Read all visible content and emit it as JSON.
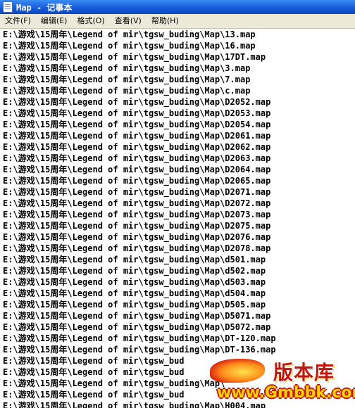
{
  "window": {
    "title": "Map - 记事本",
    "icon": "notepad-icon"
  },
  "menu": [
    {
      "label": "文件(F)",
      "name": "menu-file"
    },
    {
      "label": "编辑(E)",
      "name": "menu-edit"
    },
    {
      "label": "格式(O)",
      "name": "menu-format"
    },
    {
      "label": "查看(V)",
      "name": "menu-view"
    },
    {
      "label": "帮助(H)",
      "name": "menu-help"
    }
  ],
  "editor": {
    "lines": [
      "E:\\游戏\\15周年\\Legend of mir\\tgsw_buding\\Map\\13.map",
      "E:\\游戏\\15周年\\Legend of mir\\tgsw_buding\\Map\\16.map",
      "E:\\游戏\\15周年\\Legend of mir\\tgsw_buding\\Map\\17DT.map",
      "E:\\游戏\\15周年\\Legend of mir\\tgsw_buding\\Map\\3.map",
      "E:\\游戏\\15周年\\Legend of mir\\tgsw_buding\\Map\\7.map",
      "E:\\游戏\\15周年\\Legend of mir\\tgsw_buding\\Map\\c.map",
      "E:\\游戏\\15周年\\Legend of mir\\tgsw_buding\\Map\\D2052.map",
      "E:\\游戏\\15周年\\Legend of mir\\tgsw_buding\\Map\\D2053.map",
      "E:\\游戏\\15周年\\Legend of mir\\tgsw_buding\\Map\\D2054.map",
      "E:\\游戏\\15周年\\Legend of mir\\tgsw_buding\\Map\\D2061.map",
      "E:\\游戏\\15周年\\Legend of mir\\tgsw_buding\\Map\\D2062.map",
      "E:\\游戏\\15周年\\Legend of mir\\tgsw_buding\\Map\\D2063.map",
      "E:\\游戏\\15周年\\Legend of mir\\tgsw_buding\\Map\\D2064.map",
      "E:\\游戏\\15周年\\Legend of mir\\tgsw_buding\\Map\\D2065.map",
      "E:\\游戏\\15周年\\Legend of mir\\tgsw_buding\\Map\\D2071.map",
      "E:\\游戏\\15周年\\Legend of mir\\tgsw_buding\\Map\\D2072.map",
      "E:\\游戏\\15周年\\Legend of mir\\tgsw_buding\\Map\\D2073.map",
      "E:\\游戏\\15周年\\Legend of mir\\tgsw_buding\\Map\\D2075.map",
      "E:\\游戏\\15周年\\Legend of mir\\tgsw_buding\\Map\\D2076.map",
      "E:\\游戏\\15周年\\Legend of mir\\tgsw_buding\\Map\\D2078.map",
      "E:\\游戏\\15周年\\Legend of mir\\tgsw_buding\\Map\\d501.map",
      "E:\\游戏\\15周年\\Legend of mir\\tgsw_buding\\Map\\d502.map",
      "E:\\游戏\\15周年\\Legend of mir\\tgsw_buding\\Map\\d503.map",
      "E:\\游戏\\15周年\\Legend of mir\\tgsw_buding\\Map\\d504.map",
      "E:\\游戏\\15周年\\Legend of mir\\tgsw_buding\\Map\\D505.map",
      "E:\\游戏\\15周年\\Legend of mir\\tgsw_buding\\Map\\D5071.map",
      "E:\\游戏\\15周年\\Legend of mir\\tgsw_buding\\Map\\D5072.map",
      "E:\\游戏\\15周年\\Legend of mir\\tgsw_buding\\Map\\DT-120.map",
      "E:\\游戏\\15周年\\Legend of mir\\tgsw_buding\\Map\\DT-136.map",
      "E:\\游戏\\15周年\\Legend of mir\\tgsw_bud",
      "E:\\游戏\\15周年\\Legend of mir\\tgsw_bud",
      "E:\\游戏\\15周年\\Legend of mir\\tgsw_buding\\Map\\",
      "E:\\游戏\\15周年\\Legend of mir\\tgsw_bud",
      "E:\\游戏\\15周年\\Legend of mir\\tgsw_buding\\Map\\H004.map"
    ]
  },
  "watermark": {
    "title": "版本库",
    "url": "www.Gmbbk.com"
  }
}
